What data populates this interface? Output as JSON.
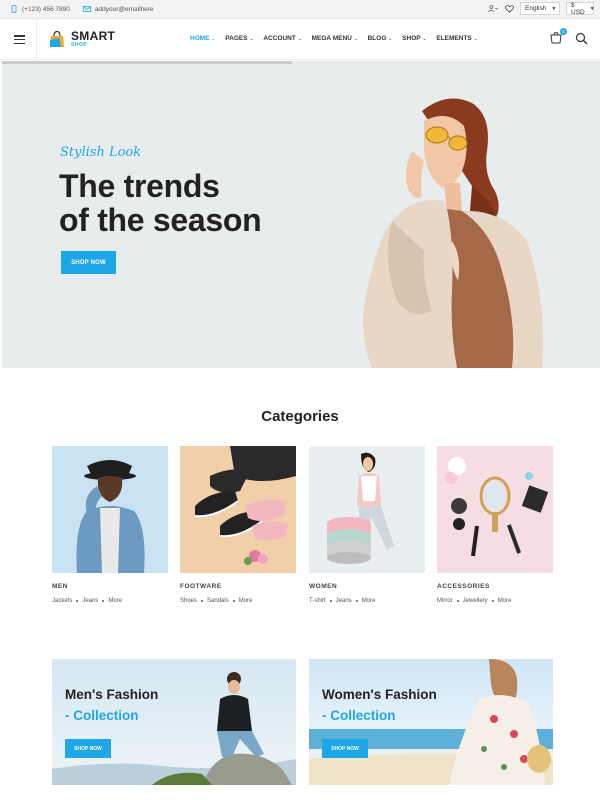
{
  "topbar": {
    "phone": "(+123) 456 7890",
    "email": "addyour@emailhere",
    "language": "English",
    "currency": "$ USD"
  },
  "header": {
    "logo_main": "SMART",
    "logo_sub": "SHOP",
    "cart_count": "0",
    "nav": [
      {
        "label": "HOME",
        "active": true
      },
      {
        "label": "PAGES"
      },
      {
        "label": "ACCOUNT"
      },
      {
        "label": "MEGA MENU"
      },
      {
        "label": "BLOG"
      },
      {
        "label": "SHOP"
      },
      {
        "label": "ELEMENTS"
      }
    ]
  },
  "hero": {
    "subtitle": "Stylish Look",
    "title_line1": "The trends",
    "title_line2": "of the season",
    "button": "SHOP NOW"
  },
  "categories": {
    "heading": "Categories",
    "items": [
      {
        "name": "MEN",
        "subs": [
          "Jackets",
          "Jeans",
          "More"
        ]
      },
      {
        "name": "FOOTWARE",
        "subs": [
          "Shoes",
          "Sandals",
          "More"
        ]
      },
      {
        "name": "WOMEN",
        "subs": [
          "T-shirt",
          "Jeans",
          "More"
        ]
      },
      {
        "name": "ACCESSORIES",
        "subs": [
          "Mirror",
          "Jewellery",
          "More"
        ]
      }
    ]
  },
  "banners": [
    {
      "line1": "Men's Fashion",
      "line2": "- Collection",
      "button": "SHOP NOW"
    },
    {
      "line1": "Women's Fashion",
      "line2": "- Collection",
      "button": "SHOP NOW"
    }
  ],
  "colors": {
    "accent": "#1ea7e8",
    "hero_bg": "#e9ecec",
    "topbar_bg": "#f3f3f3"
  }
}
